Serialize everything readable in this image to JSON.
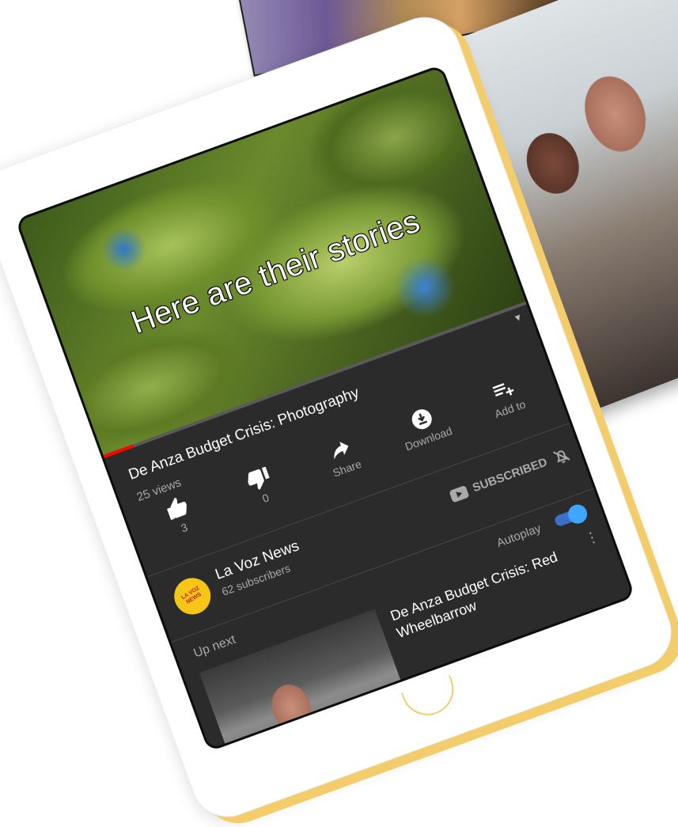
{
  "video": {
    "caption": "Here are their stories",
    "progress_percent": 7,
    "title": "De Anza Budget Crisis: Photography",
    "views": "25 views"
  },
  "actions": {
    "like_count": "3",
    "dislike_count": "0",
    "share_label": "Share",
    "download_label": "Download",
    "add_to_label": "Add to"
  },
  "channel": {
    "name": "La Voz News",
    "subscribers": "62 subscribers",
    "subscribe_state": "SUBSCRIBED",
    "logo_text": "LA VOZ NEWS"
  },
  "up_next": {
    "label": "Up next",
    "autoplay_label": "Autoplay",
    "autoplay_on": true,
    "next_title": "De Anza Budget Crisis: Red Wheelbarrow"
  },
  "colors": {
    "progress": "#ff0000",
    "toggle_on": "#3ea6ff",
    "accent_bezel": "#f3cd6b"
  },
  "icons": [
    "thumbs-up-icon",
    "thumbs-down-icon",
    "share-icon",
    "download-icon",
    "add-to-playlist-icon",
    "bell-off-icon",
    "youtube-icon",
    "more-vert-icon"
  ]
}
